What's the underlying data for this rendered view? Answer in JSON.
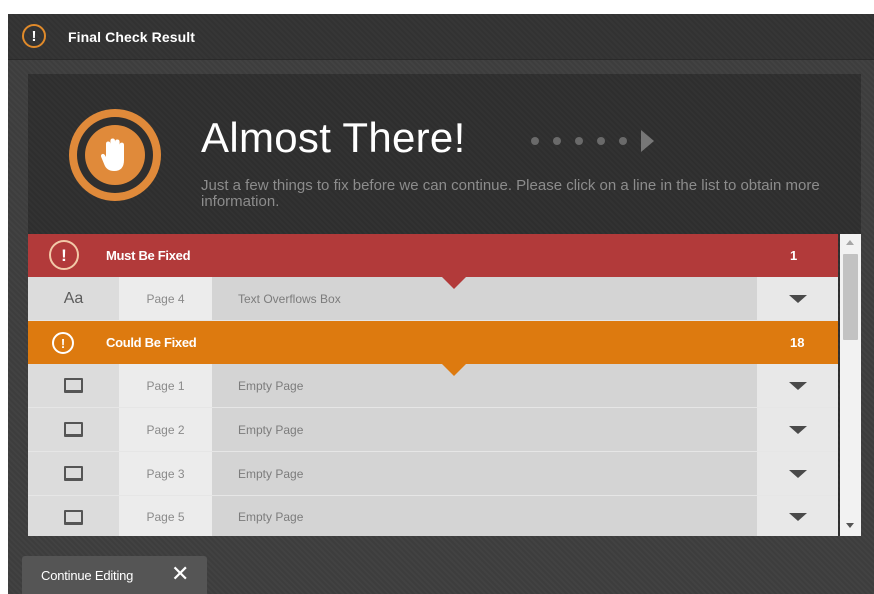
{
  "dialog": {
    "title": "Final Check Result",
    "title_icon": "exclamation-circle-icon"
  },
  "hero": {
    "icon": "hand-stop-icon",
    "title": "Almost There!",
    "subtitle": "Just a few things to fix before we can continue. Please click on a line in the list to obtain more information."
  },
  "categories": [
    {
      "label": "Must Be Fixed",
      "count": "1",
      "icon": "exclamation-circle-icon",
      "color": "#b23a3a",
      "items": [
        {
          "icon": "text-aa-icon",
          "icon_text": "Aa",
          "page": "Page 4",
          "issue": "Text Overflows Box"
        }
      ]
    },
    {
      "label": "Could Be Fixed",
      "count": "18",
      "icon": "exclamation-circle-icon",
      "color": "#dd7a0f",
      "items": [
        {
          "icon": "page-icon",
          "page": "Page 1",
          "issue": "Empty Page"
        },
        {
          "icon": "page-icon",
          "page": "Page 2",
          "issue": "Empty Page"
        },
        {
          "icon": "page-icon",
          "page": "Page 3",
          "issue": "Empty Page"
        },
        {
          "icon": "page-icon",
          "page": "Page 5",
          "issue": "Empty Page"
        }
      ]
    }
  ],
  "footer": {
    "continue_label": "Continue Editing",
    "close_glyph": "✕"
  }
}
